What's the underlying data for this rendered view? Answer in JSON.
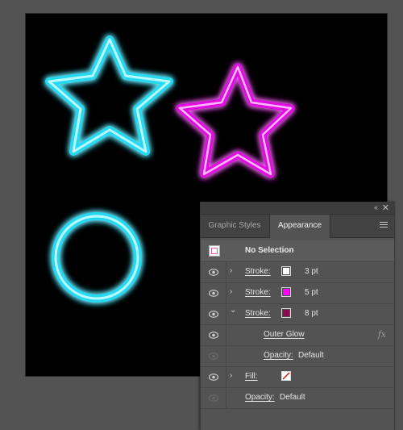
{
  "canvas": {
    "shapes": [
      {
        "name": "cyan-neon-star",
        "color": "#2ee6ff"
      },
      {
        "name": "magenta-neon-star",
        "color": "#ff19ff"
      },
      {
        "name": "cyan-neon-circle",
        "color": "#2ee6ff"
      }
    ]
  },
  "panel": {
    "tabs": [
      {
        "label": "Graphic Styles",
        "active": false
      },
      {
        "label": "Appearance",
        "active": true
      }
    ],
    "header": {
      "label": "No Selection"
    },
    "rows": [
      {
        "label": "Stroke:",
        "swatch": "#ffffff",
        "value": "3 pt",
        "chevron": "›",
        "visible": true
      },
      {
        "label": "Stroke:",
        "swatch": "#ff00ff",
        "value": "5 pt",
        "chevron": "›",
        "visible": true
      },
      {
        "label": "Stroke:",
        "swatch": "#8b0a50",
        "value": "8 pt",
        "chevron": "⌄",
        "visible": true
      },
      {
        "label": "Outer Glow",
        "fx": "fx",
        "visible": true
      },
      {
        "label": "Opacity:",
        "value": "Default",
        "visible": false
      },
      {
        "label": "Fill:",
        "swatch": "none-red-slash",
        "chevron": "›",
        "visible": true
      },
      {
        "label": "Opacity:",
        "value": "Default",
        "visible": false
      }
    ]
  },
  "icons": {
    "collapse": "«",
    "close": "✕",
    "eye": "eye-icon",
    "menu": "hamburger-menu-icon"
  }
}
